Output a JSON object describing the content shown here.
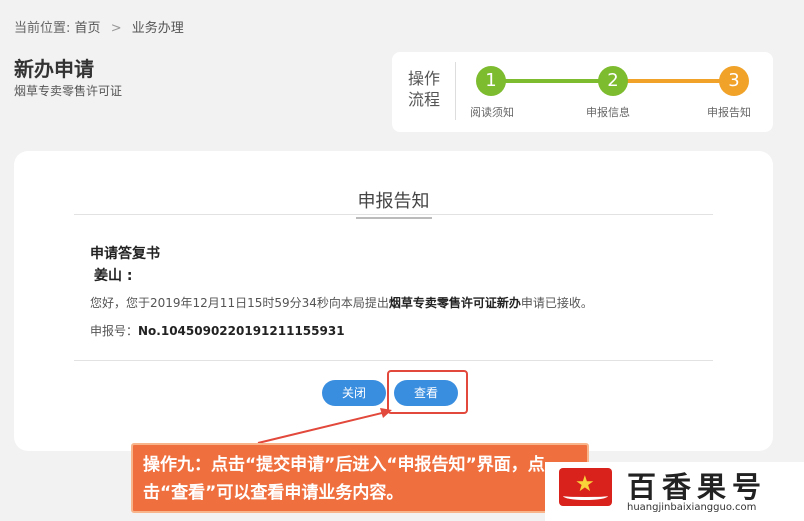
{
  "breadcrumb": {
    "prefix": "当前位置:",
    "home": "首页",
    "separator": ">",
    "current": "业务办理"
  },
  "page": {
    "title": "新办申请",
    "subtitle": "烟草专卖零售许可证"
  },
  "steps": {
    "label": "操作流程",
    "items": [
      {
        "number": "1",
        "label": "阅读须知",
        "color": "#7dbb2f"
      },
      {
        "number": "2",
        "label": "申报信息",
        "color": "#7dbb2f"
      },
      {
        "number": "3",
        "label": "申报告知",
        "color": "#f0a229"
      }
    ]
  },
  "notice": {
    "section_title": "申报告知",
    "reply_title": "申请答复书",
    "addressee": "姜山 :",
    "message_prefix": "您好，您于2019年12月11日15时59分34秒向本局提出",
    "message_bold": "烟草专卖零售许可证新办",
    "message_suffix": "申请已接收。",
    "appno_label": "申报号：",
    "appno_value": "No.104509022019121115593​1"
  },
  "buttons": {
    "close": "关闭",
    "view": "查看"
  },
  "callout": {
    "text": "操作九：点击“提交申请”后进入“申报告知”界面，点击“查看”可以查看申请业务内容。"
  },
  "watermark": {
    "brand": "百香果号",
    "domain": "huangjinbaixiangguo.com"
  },
  "colors": {
    "accent": "#3a8ee0",
    "done": "#7dbb2f",
    "current": "#f0a229",
    "callout": "#f06f3f"
  }
}
